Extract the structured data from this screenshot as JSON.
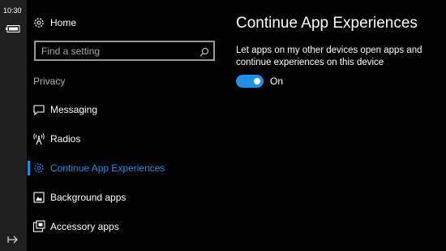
{
  "status": {
    "time": "10:30"
  },
  "nav": {
    "home_label": "Home",
    "search": {
      "placeholder": "Find a setting",
      "value": ""
    },
    "section_header": "Privacy",
    "items": [
      {
        "label": "Messaging",
        "icon": "message-icon"
      },
      {
        "label": "Radios",
        "icon": "radio-tower-icon"
      },
      {
        "label": "Continue App Experiences",
        "icon": "gear-icon",
        "selected": true
      },
      {
        "label": "Background apps",
        "icon": "background-apps-icon"
      },
      {
        "label": "Accessory apps",
        "icon": "accessory-apps-icon"
      }
    ]
  },
  "content": {
    "title": "Continue App Experiences",
    "description": "Let apps on my other devices open apps and continue experiences on this device",
    "toggle": {
      "state": "On",
      "on": true
    }
  },
  "colors": {
    "accent": "#1e90e6",
    "background": "#000000",
    "statusbar": "#1f1f1f"
  }
}
